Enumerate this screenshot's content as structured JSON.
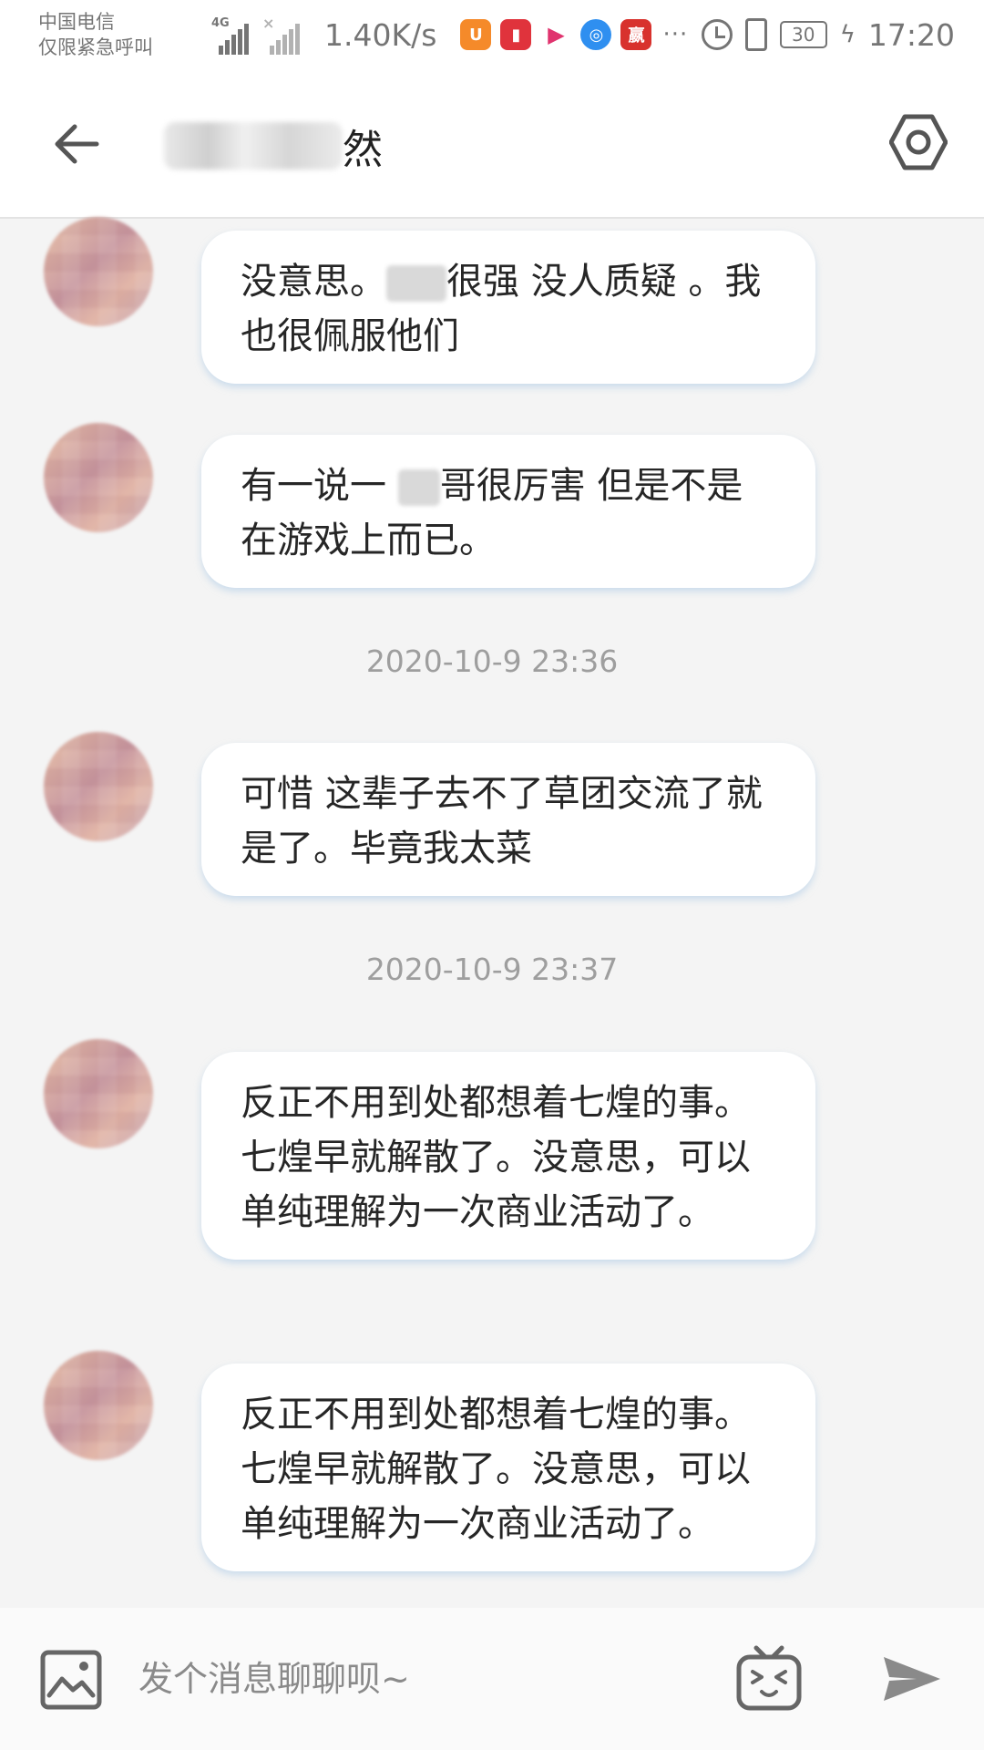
{
  "status_bar": {
    "carrier_line1": "中国电信",
    "carrier_line2": "仅限紧急呼叫",
    "network_tag": "4G",
    "net_speed": "1.40K/s",
    "app_icons": [
      "uc-browser-icon",
      "book-app-icon",
      "youku-icon",
      "browser-icon",
      "news-app-icon"
    ],
    "more_dots": "···",
    "battery_level": "30",
    "time": "17:20"
  },
  "header": {
    "title_visible": "然",
    "back_icon": "arrow-left-icon",
    "settings_icon": "hexagon-settings-icon"
  },
  "conversation": {
    "messages": [
      {
        "text_before": "没意思。",
        "text_after": "很强 没人质疑 。我也很佩服他们"
      },
      {
        "text_before": "有一说一 ",
        "text_after": "哥很厉害  但是不是在游戏上而已。"
      },
      {
        "timestamp": "2020-10-9 23:36"
      },
      {
        "text": "可惜  这辈子去不了草团交流了就是了。毕竟我太菜"
      },
      {
        "timestamp": "2020-10-9 23:37"
      },
      {
        "text": "反正不用到处都想着七煌的事。七煌早就解散了。没意思，可以单纯理解为一次商业活动了。"
      },
      {
        "text": "反正不用到处都想着七煌的事。七煌早就解散了。没意思，可以单纯理解为一次商业活动了。"
      }
    ]
  },
  "input_bar": {
    "placeholder": "发个消息聊聊呗~",
    "image_icon": "image-icon",
    "emoji_icon": "tv-emoji-icon",
    "send_icon": "send-icon"
  },
  "colors": {
    "background": "#f4f4f4",
    "bubble": "#ffffff",
    "bubble_shadow": "#aac8e6",
    "icon_gray": "#757575",
    "timestamp": "#9e9e9e"
  }
}
